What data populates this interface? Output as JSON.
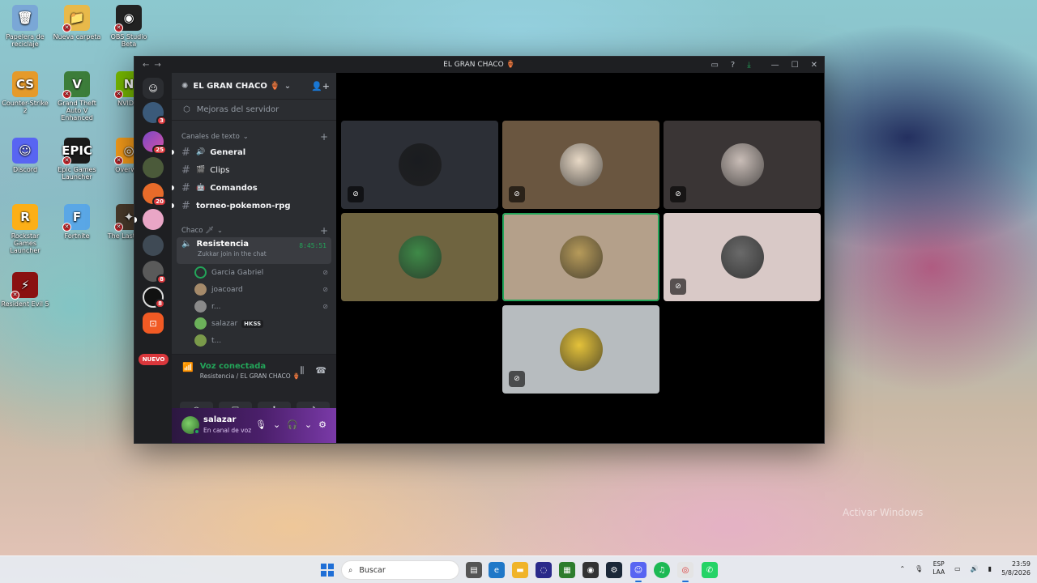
{
  "desktop": {
    "icons": [
      {
        "label": "Papelera de reciclaje",
        "glyph": "🗑",
        "color": "#7aa7d6"
      },
      {
        "label": "Nueva carpeta",
        "glyph": "📁",
        "color": "#e8b94a"
      },
      {
        "label": "OBS Studio Beta",
        "glyph": "◉",
        "color": "#222222"
      },
      {
        "label": "Counter-Strike 2",
        "glyph": "CS",
        "color": "#e59a2a"
      },
      {
        "label": "Grand Theft Auto V Enhanced",
        "glyph": "V",
        "color": "#3c7d3a"
      },
      {
        "label": "NVIDIA",
        "glyph": "N",
        "color": "#76b900"
      },
      {
        "label": "Discord",
        "glyph": "☺",
        "color": "#5865f2"
      },
      {
        "label": "Epic Games Launcher",
        "glyph": "EPIC",
        "color": "#1b1b1b"
      },
      {
        "label": "Overwat",
        "glyph": "◎",
        "color": "#f99e1a"
      },
      {
        "label": "Rockstar Games Launcher",
        "glyph": "R",
        "color": "#fcaf17"
      },
      {
        "label": "Fortnite",
        "glyph": "F",
        "color": "#5aa7e6"
      },
      {
        "label": "The Last Part",
        "glyph": "✦",
        "color": "#4a3b2c"
      },
      {
        "label": "Resident Evil 5",
        "glyph": "⚡",
        "color": "#8a1111"
      }
    ],
    "watermark": "Activar Windows"
  },
  "window": {
    "title": "EL GRAN CHACO 🏺",
    "nav_back": "←",
    "nav_fwd": "→"
  },
  "guilds": {
    "home_glyph": "☺",
    "badges": [
      "3",
      "25",
      "20",
      "8",
      "8"
    ],
    "nuevo_label": "NUEVO"
  },
  "sidebar": {
    "server_name": "EL GRAN CHACO 🏺",
    "boost_label": "Mejoras del servidor",
    "text_category": "Canales de texto",
    "text_channels": [
      {
        "emoji": "🔊",
        "name": "General"
      },
      {
        "emoji": "🎬",
        "name": "Clips"
      },
      {
        "emoji": "🤖",
        "name": "Comandos"
      },
      {
        "emoji": "",
        "name": "torneo-pokemon-rpg"
      }
    ],
    "voice_category": "Chaco 🗡",
    "voice_channel": {
      "name": "Resistencia",
      "time": "8:45:51",
      "status": "Zukkar join in the chat"
    },
    "voice_users": [
      {
        "name": "Garcia Gabriel",
        "color": "#2b2d31"
      },
      {
        "name": "joacoard",
        "color": "#a58a6a"
      },
      {
        "name": "r...",
        "color": "#8a8a8a"
      },
      {
        "name": "salazar",
        "color": "#6cb15a",
        "tag": "HKSS"
      },
      {
        "name": "t...",
        "color": "#7a9a4a"
      }
    ]
  },
  "voice_panel": {
    "title": "Voz conectada",
    "subtitle": "Resistencia / EL GRAN CHACO 🏺"
  },
  "user_panel": {
    "name": "salazar",
    "status": "En canal de voz"
  },
  "tiles": [
    {
      "bg": "#2c2f36",
      "avatar": "#1a1c20",
      "muted": true,
      "speaking": false
    },
    {
      "bg": "#6a5640",
      "avatar": "#e8d9c6",
      "muted": true,
      "speaking": false
    },
    {
      "bg": "#3a3535",
      "avatar": "#c9bdb7",
      "muted": true,
      "speaking": false
    },
    {
      "bg": "#6f6440",
      "avatar": "#3f8a48",
      "muted": false,
      "speaking": false
    },
    {
      "bg": "#b4a08a",
      "avatar": "#b79b5a",
      "muted": false,
      "speaking": true
    },
    {
      "bg": "#d9c9c7",
      "avatar": "#6a6a6a",
      "muted": true,
      "speaking": false
    },
    {
      "bg": "#b7bcbf",
      "avatar": "#e4c23a",
      "muted": true,
      "speaking": false
    }
  ],
  "taskbar": {
    "search_placeholder": "Buscar",
    "lang_top": "ESP",
    "lang_bottom": "LAA",
    "time": "23:59",
    "date": "5/8/2026"
  }
}
